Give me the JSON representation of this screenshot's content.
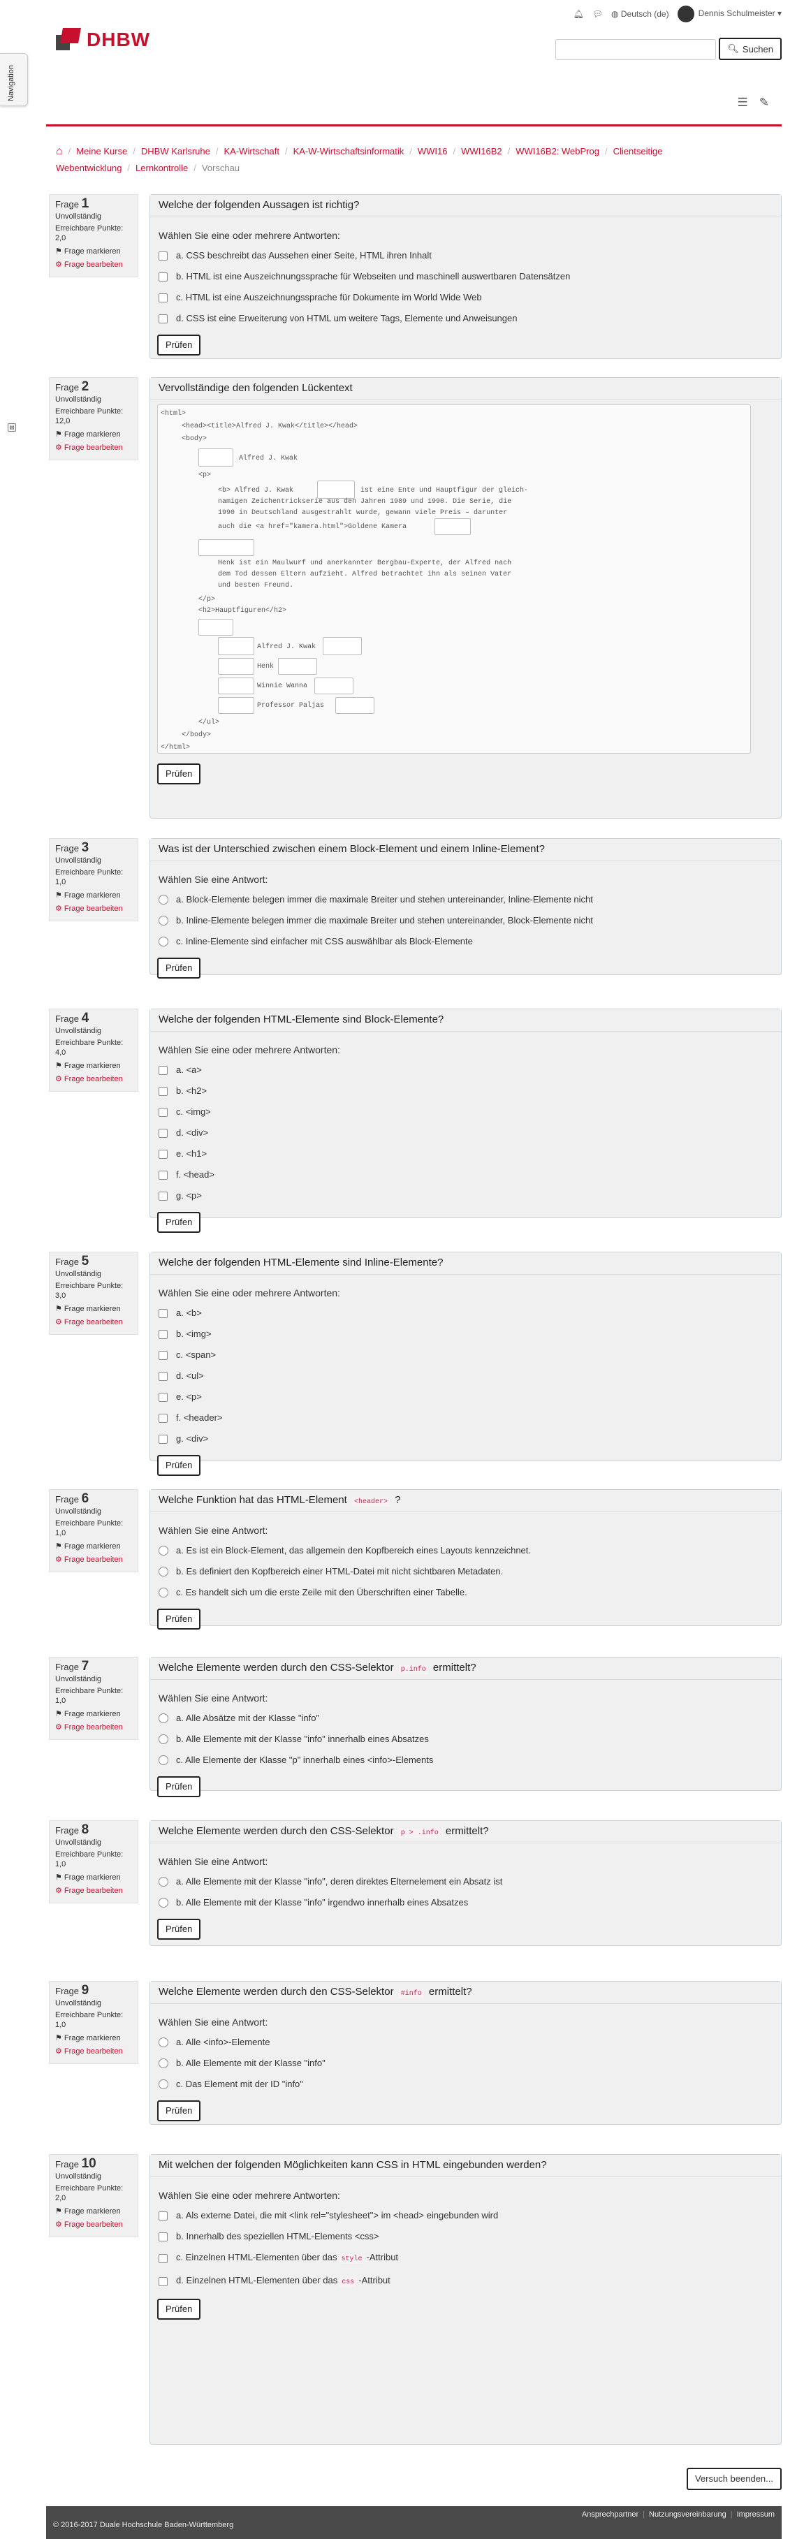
{
  "nav_drawer_label": "Navigation",
  "topbar": {
    "language": "Deutsch (de)",
    "user": "Dennis Schulmeister"
  },
  "logo_text": "DHBW",
  "search": {
    "placeholder": "",
    "button": "Suchen"
  },
  "breadcrumb": [
    "Meine Kurse",
    "DHBW Karlsruhe",
    "KA-Wirtschaft",
    "KA-W-Wirtschaftsinformatik",
    "WWI16",
    "WWI16B2",
    "WWI16B2: WebProg",
    "Clientseitige Webentwicklung",
    "Lernkontrolle",
    "Vorschau"
  ],
  "labels": {
    "frage": "Frage",
    "status": "Unvollständig",
    "points_prefix": "Erreichbare Punkte:",
    "flag": "Frage markieren",
    "edit": "Frage bearbeiten",
    "check": "Prüfen",
    "multi": "Wählen Sie eine oder mehrere Antworten:",
    "single": "Wählen Sie eine Antwort:"
  },
  "questions": [
    {
      "no": "1",
      "points": "2,0",
      "text": "Welche der folgenden Aussagen ist richtig?",
      "options": [
        "a. CSS beschreibt das Aussehen einer Seite, HTML ihren Inhalt",
        "b. HTML ist eine Auszeichnungssprache für Webseiten und maschinell auswertbaren Datensätzen",
        "c. HTML ist eine Auszeichnungssprache für Dokumente im World Wide Web",
        "d. CSS ist eine Erweiterung von HTML um weitere Tags, Elemente und Anweisungen"
      ]
    },
    {
      "no": "2",
      "points": "12,0",
      "text": "Vervollständige den folgenden Lückentext"
    },
    {
      "no": "3",
      "points": "1,0",
      "text": "Was ist der Unterschied zwischen einem Block-Element und einem Inline-Element?",
      "options": [
        "a. Block-Elemente belegen immer die maximale Breiter und stehen untereinander, Inline-Elemente nicht",
        "b. Inline-Elemente belegen immer die maximale Breiter und stehen untereinander, Block-Elemente nicht",
        "c. Inline-Elemente sind einfacher mit CSS auswählbar als Block-Elemente"
      ]
    },
    {
      "no": "4",
      "points": "4,0",
      "text": "Welche der folgenden HTML-Elemente sind Block-Elemente?",
      "options": [
        "a. <a>",
        "b. <h2>",
        "c. <img>",
        "d. <div>",
        "e. <h1>",
        "f. <head>",
        "g. <p>"
      ]
    },
    {
      "no": "5",
      "points": "3,0",
      "text": "Welche der folgenden HTML-Elemente sind Inline-Elemente?",
      "options": [
        "a. <b>",
        "b. <img>",
        "c. <span>",
        "d. <ul>",
        "e. <p>",
        "f. <header>",
        "g. <div>"
      ]
    },
    {
      "no": "6",
      "points": "1,0",
      "text_pre": "Welche Funktion hat das HTML-Element",
      "code": "<header>",
      "text_post": "?",
      "options": [
        "a. Es ist ein Block-Element, das allgemein den Kopfbereich eines Layouts kennzeichnet.",
        "b. Es definiert den Kopfbereich einer HTML-Datei mit nicht sichtbaren Metadaten.",
        "c. Es handelt sich um die erste Zeile mit den Überschriften einer Tabelle."
      ]
    },
    {
      "no": "7",
      "points": "1,0",
      "text_pre": "Welche Elemente werden durch den CSS-Selektor",
      "code": "p.info",
      "text_post": "ermittelt?",
      "options": [
        "a. Alle Absätze mit der Klasse \"info\"",
        "b. Alle Elemente mit der Klasse \"info\" innerhalb eines Absatzes",
        "c. Alle Elemente der Klasse \"p\" innerhalb eines <info>-Elements"
      ]
    },
    {
      "no": "8",
      "points": "1,0",
      "text_pre": "Welche Elemente werden durch den CSS-Selektor",
      "code": "p > .info",
      "text_post": "ermittelt?",
      "options": [
        "a. Alle Elemente mit der Klasse \"info\", deren direktes Elternelement ein Absatz ist",
        "b. Alle Elemente mit der Klasse \"info\" irgendwo innerhalb eines Absatzes"
      ]
    },
    {
      "no": "9",
      "points": "1,0",
      "text_pre": "Welche Elemente werden durch den CSS-Selektor",
      "code": "#info",
      "text_post": "ermittelt?",
      "options": [
        "a. Alle <info>-Elemente",
        "b. Alle Elemente mit der Klasse \"info\"",
        "c. Das Element mit der ID \"info\""
      ]
    },
    {
      "no": "10",
      "points": "2,0",
      "text": "Mit welchen der folgenden Möglichkeiten kann CSS in HTML eingebunden werden?",
      "options": [
        "a. Als externe Datei, die mit <link rel=\"stylesheet\"> im <head> eingebunden wird",
        "b. Innerhalb des speziellen HTML-Elements <css>"
      ],
      "options_code": [
        {
          "pre": "c. Einzelnen HTML-Elementen über das",
          "code": "style",
          "post": "-Attribut"
        },
        {
          "pre": "d. Einzelnen HTML-Elementen über das",
          "code": "css",
          "post": "-Attribut"
        }
      ]
    }
  ],
  "cloze": {
    "lines": [
      "<html>",
      "<head><title>Alfred J. Kwak</title></head>",
      "<body>",
      "Alfred J. Kwak",
      "<p>",
      "<b> Alfred J. Kwak",
      "ist eine Ente und Hauptfigur der gleich-",
      "namigen Zeichentrickserie aus den Jahren 1989 und 1990. Die Serie, die",
      "1990 in Deutschland ausgestrahlt wurde, gewann viele Preis – darunter",
      "auch die <a href=\"kamera.html\">Goldene Kamera",
      "Henk ist ein Maulwurf und anerkannter Bergbau-Experte, der Alfred nach",
      "dem Tod dessen Eltern aufzieht. Alfred betrachtet ihn als seinen Vater",
      "und besten Freund.",
      "</p>",
      "<h2>Hauptfiguren</h2>",
      "Alfred J. Kwak",
      "Henk",
      "Winnie Wanna",
      "Professor Paljas",
      "</ul>",
      "</body>",
      "</html>"
    ]
  },
  "finish_button": "Versuch beenden...",
  "footer": {
    "links": [
      "Ansprechpartner",
      "Nutzungsvereinbarung",
      "Impressum"
    ],
    "copyright": "© 2016-2017 Duale Hochschule Baden-Württemberg"
  },
  "colors": {
    "brand": "#c8102e"
  }
}
